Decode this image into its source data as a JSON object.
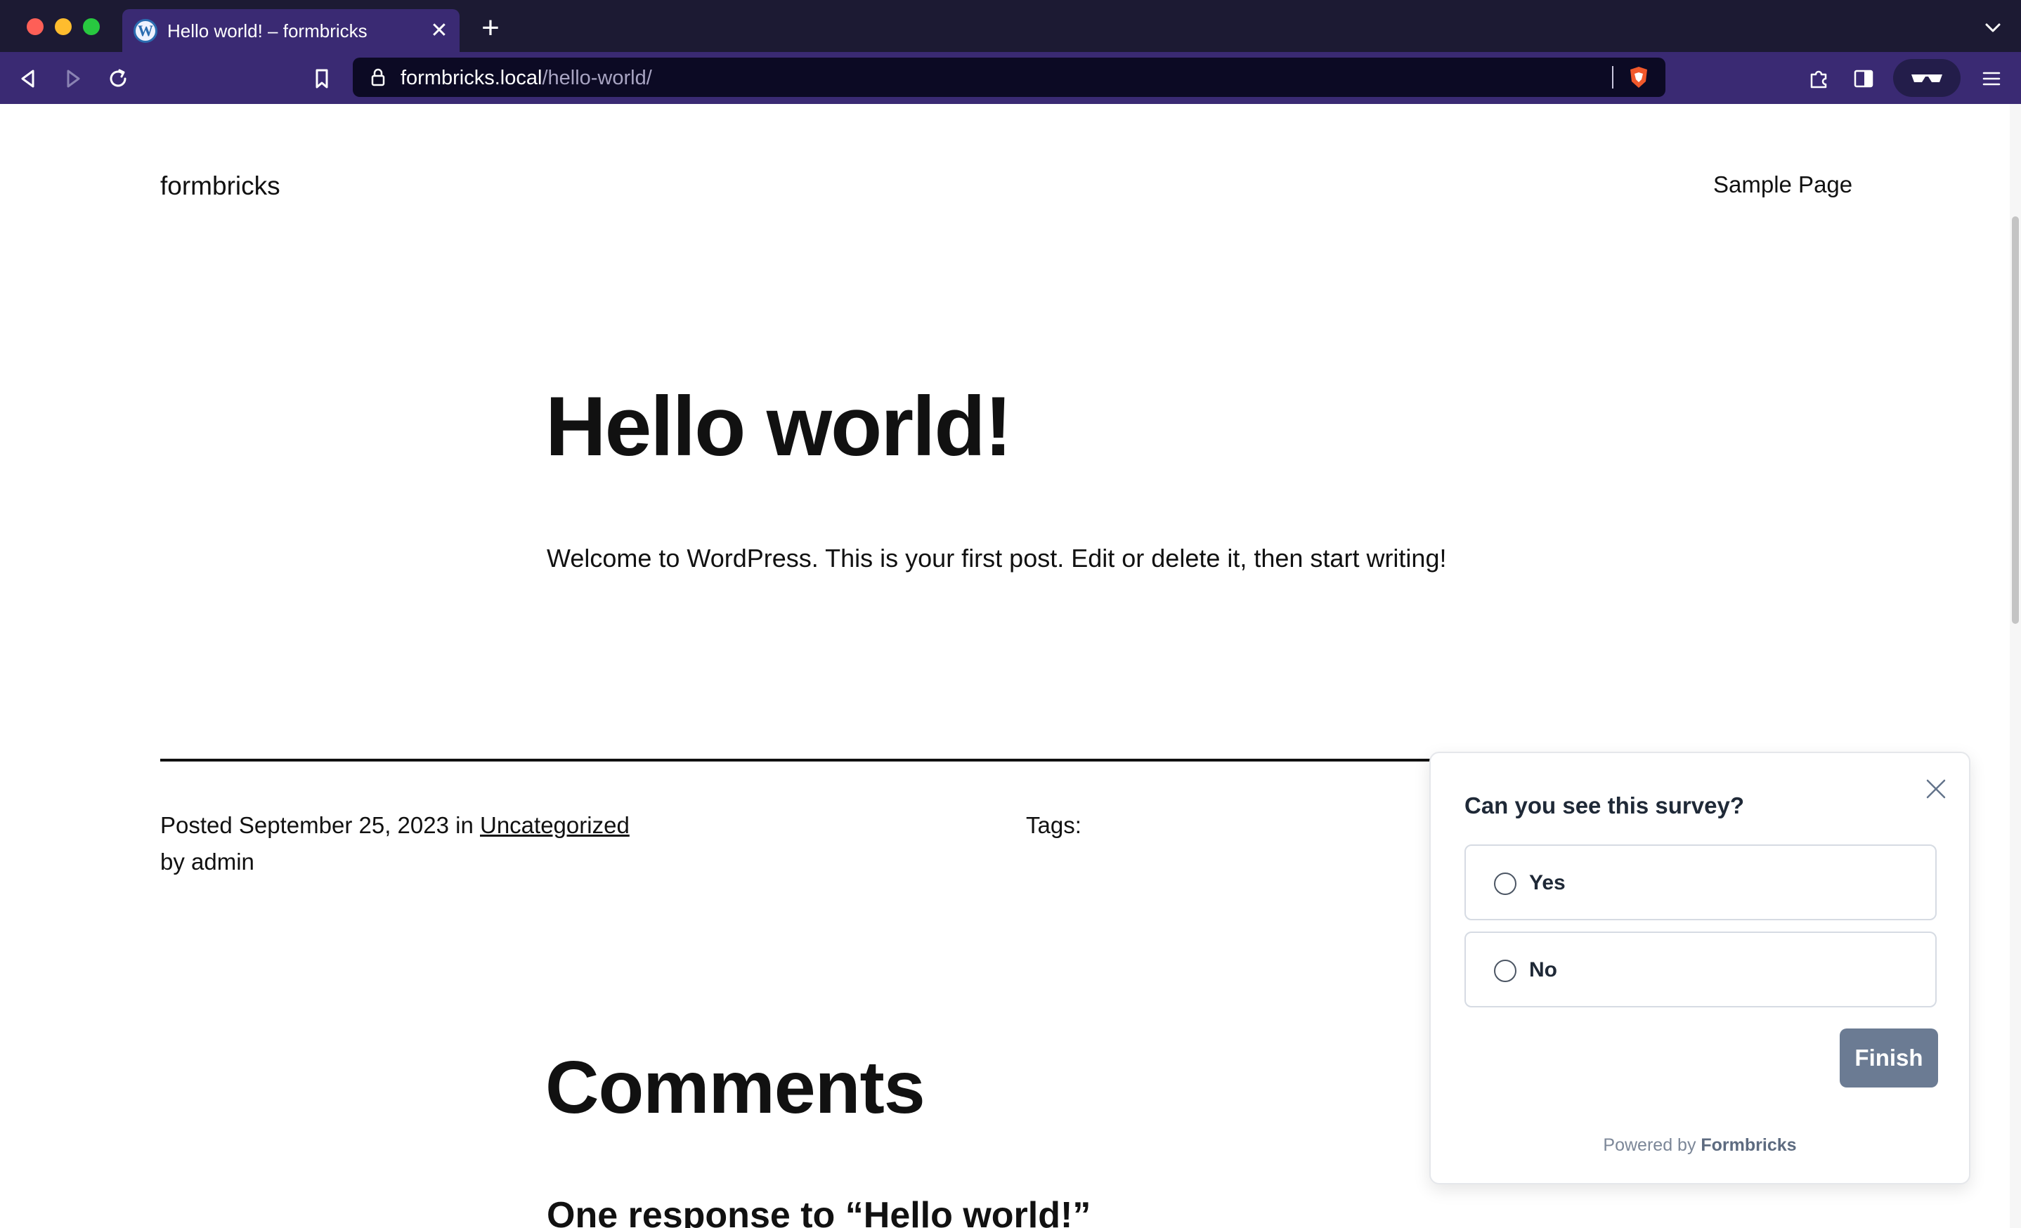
{
  "browser": {
    "tab_title": "Hello world! – formbricks",
    "tab_favicon": "W",
    "tab_close_glyph": "✕",
    "new_tab_glyph": "+",
    "url_host": "formbricks.local",
    "url_path": "/hello-world/"
  },
  "site": {
    "title": "formbricks",
    "nav_link": "Sample Page"
  },
  "post": {
    "title": "Hello world!",
    "body": "Welcome to WordPress. This is your first post. Edit or delete it, then start writing!",
    "posted_prefix": "Posted ",
    "posted_date": "September 25, 2023",
    "posted_in": " in ",
    "category": "Uncategorized",
    "by_line": "by admin",
    "tags_label": "Tags:"
  },
  "comments": {
    "heading": "Comments",
    "response_title": "One response to “Hello world!”"
  },
  "survey": {
    "question": "Can you see this survey?",
    "choices": [
      {
        "label": "Yes"
      },
      {
        "label": "No"
      }
    ],
    "finish_label": "Finish",
    "powered_prefix": "Powered by ",
    "powered_brand": "Formbricks"
  },
  "colors": {
    "tabbar_bg": "#1c1a33",
    "toolbar_bg": "#3a2a73",
    "finish_button": "#6b7b93"
  }
}
